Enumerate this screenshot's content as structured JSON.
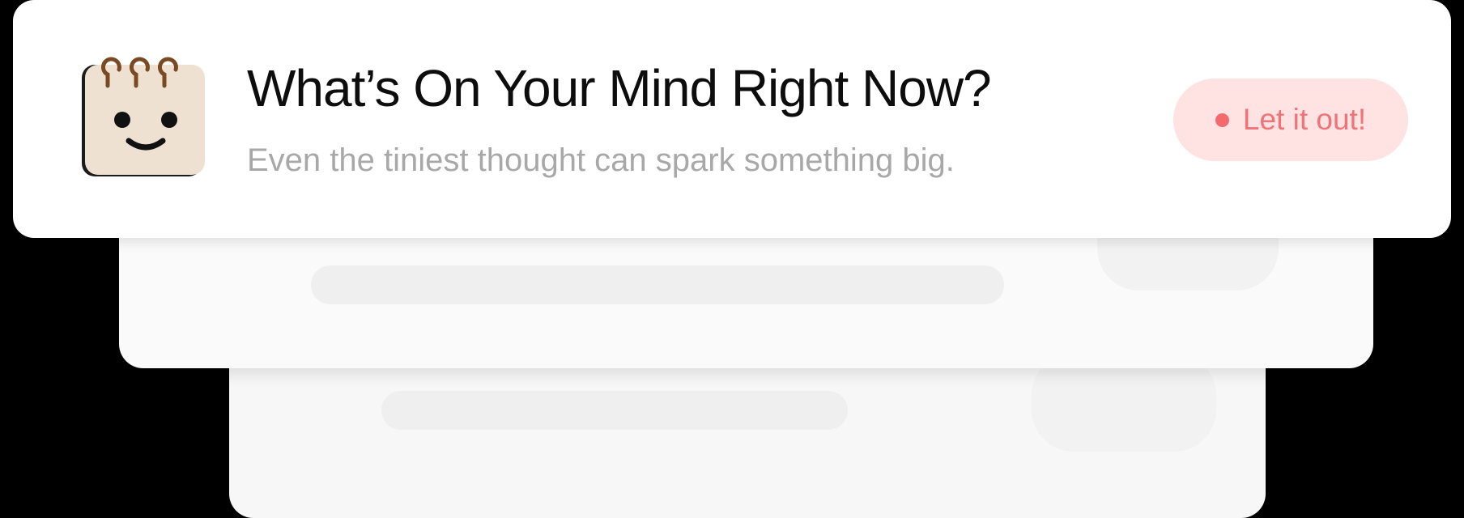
{
  "card": {
    "title": "What’s On Your Mind Right Now?",
    "subtitle": "Even the tiniest thought can spark something big.",
    "icon": "smiling-notebook-icon",
    "cta": {
      "label": "Let it out!",
      "icon": "dot-icon"
    }
  },
  "colors": {
    "background": "#000000",
    "card": "#ffffff",
    "title": "#0d0d0d",
    "subtitle": "#a8a8a8",
    "cta_background": "#ffe2e2",
    "cta_text": "#f07377",
    "cta_dot": "#f26a6e",
    "notebook_paper": "#efe1d2",
    "notebook_rings": "#7a4a24"
  }
}
